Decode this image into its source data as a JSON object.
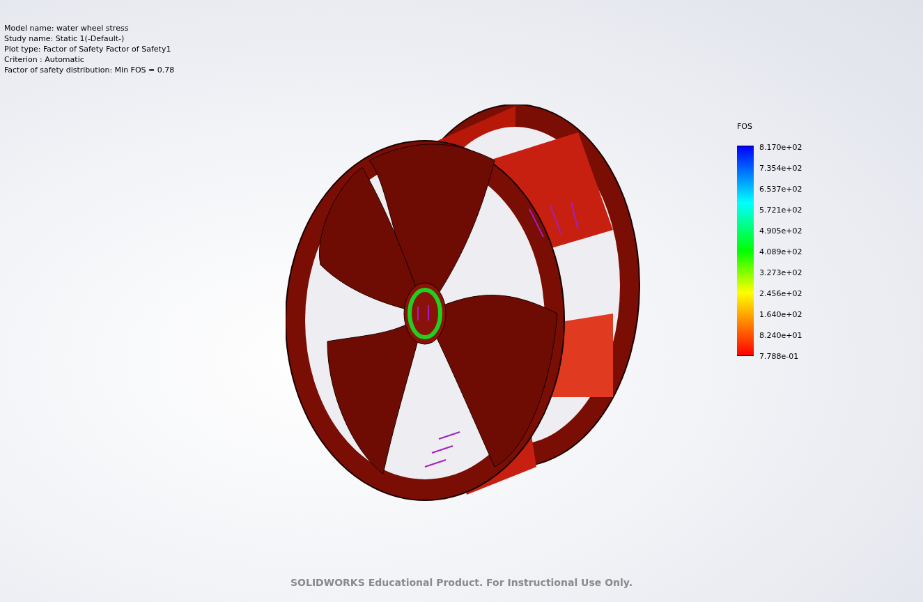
{
  "study_info": [
    "Model name: water wheel stress",
    "Study name: Static 1(-Default-)",
    "Plot type: Factor of Safety Factor of Safety1",
    "Criterion : Automatic",
    "Factor of safety distribution: Min FOS = 0.78"
  ],
  "legend": {
    "title": "FOS",
    "labels": [
      "8.170e+02",
      "7.354e+02",
      "6.537e+02",
      "5.721e+02",
      "4.905e+02",
      "4.089e+02",
      "3.273e+02",
      "2.456e+02",
      "1.640e+02",
      "8.240e+01",
      "7.788e-01"
    ]
  },
  "footer": "SOLIDWORKS Educational Product. For Instructional Use Only."
}
